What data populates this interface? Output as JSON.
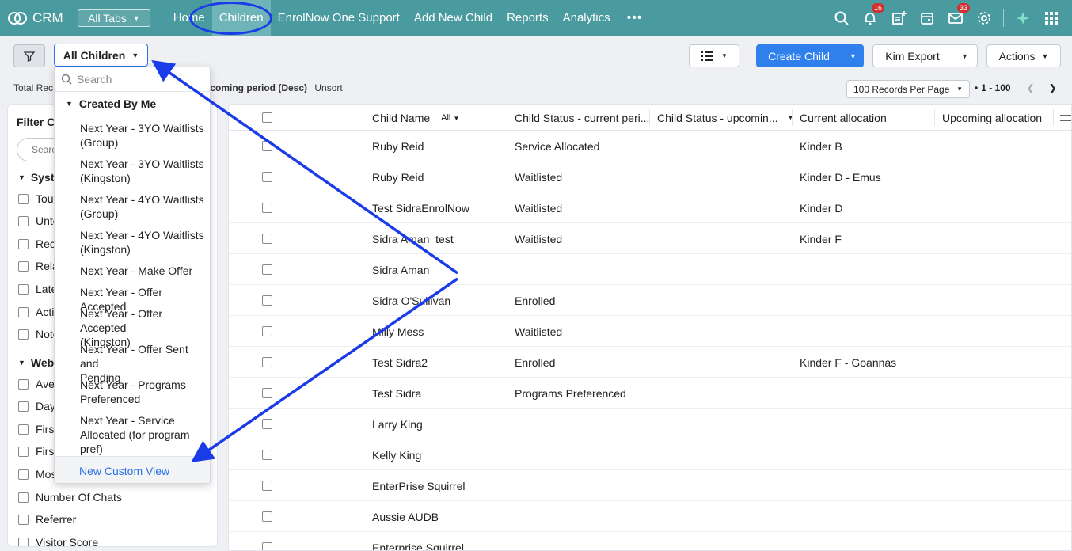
{
  "app": {
    "logo_text": "CRM"
  },
  "topnav": {
    "all_tabs_label": "All Tabs",
    "links": [
      "Home",
      "Children",
      "EnrolNow One Support",
      "Add New Child",
      "Reports",
      "Analytics"
    ],
    "more_label": "•••",
    "notifications_count": "16",
    "mail_count": "33"
  },
  "toolbar": {
    "view_label": "All Children",
    "create_label": "Create Child",
    "export_label": "Kim Export",
    "actions_label": "Actions"
  },
  "info": {
    "total_records_label": "Total Rec",
    "sort_label": "pcoming period (Desc)",
    "unsort_label": "Unsort",
    "per_page_label": "100 Records Per Page",
    "page_range": "1 - 100",
    "bullet": "•"
  },
  "filter_panel": {
    "title": "Filter Ch",
    "search_placeholder": "Searc",
    "section_system": "Syste",
    "system_items": [
      "Touc",
      "Unto",
      "Reco",
      "Rela",
      "Late",
      "Acti",
      "Note"
    ],
    "section_website": "Webs",
    "website_items": [
      "Aver",
      "Day",
      "First",
      "First",
      "Mos",
      "Number Of Chats",
      "Referrer",
      "Visitor Score"
    ]
  },
  "dropdown": {
    "search_placeholder": "Search",
    "group_label": "Created By Me",
    "items": [
      {
        "line1": "Next Year - 3YO Waitlists",
        "line2": "(Group)"
      },
      {
        "line1": "Next Year - 3YO Waitlists",
        "line2": "(Kingston)"
      },
      {
        "line1": "Next Year - 4YO Waitlists",
        "line2": "(Group)"
      },
      {
        "line1": "Next Year - 4YO Waitlists",
        "line2": "(Kingston)"
      },
      {
        "line1": "Next Year - Make Offer",
        "line2": ""
      },
      {
        "line1": "Next Year - Offer Accepted",
        "line2": ""
      },
      {
        "line1": "Next Year - Offer Accepted",
        "line2": "(Kingston)"
      },
      {
        "line1": "Next Year - Offer Sent and",
        "line2": "Pending"
      },
      {
        "line1": "Next Year - Programs",
        "line2": "Preferenced"
      },
      {
        "line1": "Next Year - Service",
        "line2": "Allocated (for program",
        "line3": "pref)"
      }
    ],
    "new_view_label": "New Custom View"
  },
  "table": {
    "headers": {
      "child_name": "Child Name",
      "child_name_filter": "All",
      "status_current": "Child Status - current peri...",
      "status_upcoming": "Child Status - upcomin...",
      "current_allocation": "Current allocation",
      "upcoming_allocation": "Upcoming allocation"
    },
    "rows": [
      {
        "name": "Ruby Reid",
        "status": "Service Allocated",
        "upcoming": "",
        "allocation": "Kinder B",
        "upcoming_alloc": ""
      },
      {
        "name": "Ruby Reid",
        "status": "Waitlisted",
        "upcoming": "",
        "allocation": "Kinder D - Emus",
        "upcoming_alloc": ""
      },
      {
        "name": "Test SidraEnrolNow",
        "status": "Waitlisted",
        "upcoming": "",
        "allocation": "Kinder D",
        "upcoming_alloc": ""
      },
      {
        "name": "Sidra Aman_test",
        "status": "Waitlisted",
        "upcoming": "",
        "allocation": "Kinder F",
        "upcoming_alloc": ""
      },
      {
        "name": "Sidra Aman",
        "status": "",
        "upcoming": "",
        "allocation": "",
        "upcoming_alloc": ""
      },
      {
        "name": "Sidra O'Sullivan",
        "status": "Enrolled",
        "upcoming": "",
        "allocation": "",
        "upcoming_alloc": ""
      },
      {
        "name": "Milly Mess",
        "status": "Waitlisted",
        "upcoming": "",
        "allocation": "",
        "upcoming_alloc": ""
      },
      {
        "name": "Test Sidra2",
        "status": "Enrolled",
        "upcoming": "",
        "allocation": "Kinder F - Goannas",
        "upcoming_alloc": ""
      },
      {
        "name": "Test Sidra",
        "status": "Programs Preferenced",
        "upcoming": "",
        "allocation": "",
        "upcoming_alloc": ""
      },
      {
        "name": "Larry King",
        "status": "",
        "upcoming": "",
        "allocation": "",
        "upcoming_alloc": ""
      },
      {
        "name": "Kelly King",
        "status": "",
        "upcoming": "",
        "allocation": "",
        "upcoming_alloc": ""
      },
      {
        "name": "EnterPrise Squirrel",
        "status": "",
        "upcoming": "",
        "allocation": "",
        "upcoming_alloc": ""
      },
      {
        "name": "Aussie AUDB",
        "status": "",
        "upcoming": "",
        "allocation": "",
        "upcoming_alloc": ""
      },
      {
        "name": "Enterprise Squirrel",
        "status": "",
        "upcoming": "",
        "allocation": "",
        "upcoming_alloc": ""
      }
    ]
  },
  "colors": {
    "nav_bg": "#4a9b9f",
    "nav_active": "#6fb4b8",
    "primary": "#2f80ed",
    "annotation": "#1a3ce8",
    "badge": "#d32f2f"
  }
}
